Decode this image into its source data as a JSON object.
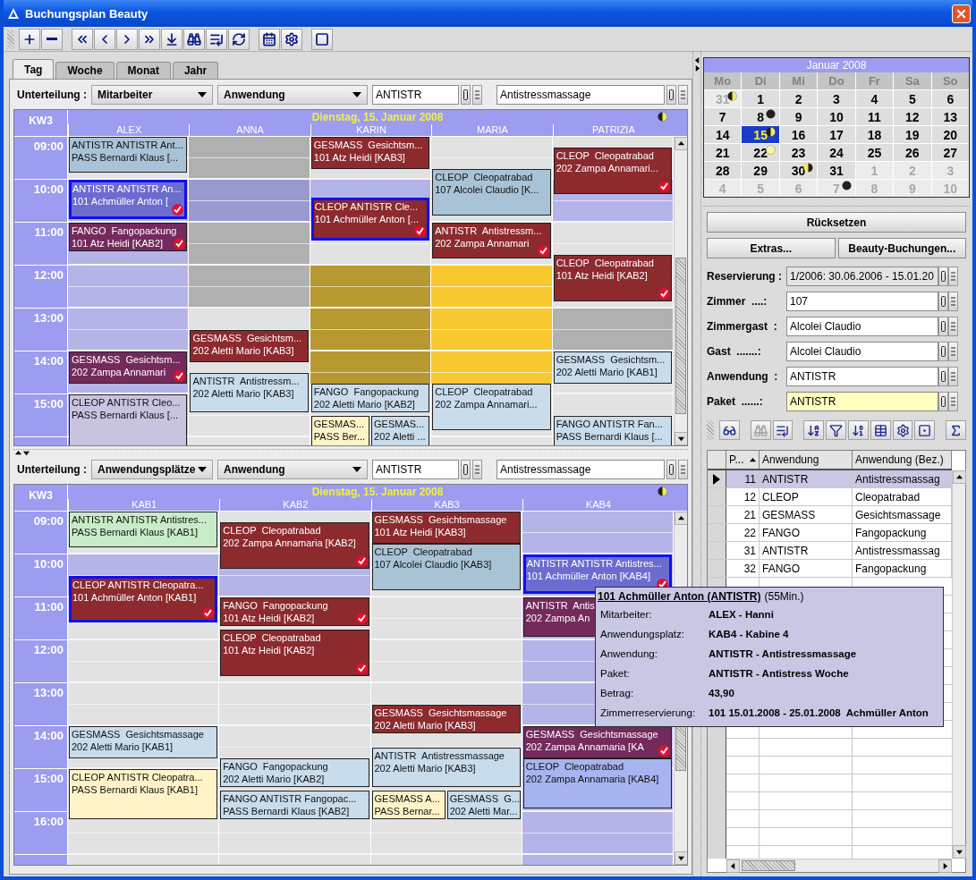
{
  "window": {
    "title": "Buchungsplan Beauty"
  },
  "view_tabs": [
    {
      "label": "Tag",
      "selected": true
    },
    {
      "label": "Woche",
      "selected": false
    },
    {
      "label": "Monat",
      "selected": false
    },
    {
      "label": "Jahr",
      "selected": false
    }
  ],
  "schedules": [
    {
      "subdivision_label": "Unterteilung :",
      "subdivision": "Mitarbeiter",
      "grouping": "Anwendung",
      "code": "ANTISTR",
      "name": "Antistressmassage",
      "week": "KW3",
      "date": "Dienstag, 15. Januar 2008",
      "hours": [
        "09:00",
        "10:00",
        "11:00",
        "12:00",
        "13:00",
        "14:00",
        "15:00"
      ],
      "columns": [
        {
          "name": "ALEX",
          "shading": [
            {
              "color": "#b4b4e8"
            }
          ],
          "events": [
            {
              "service": "ANTISTR ANTISTR Ant...",
              "guest": "PASS Bernardi Klaus [...",
              "color": "#a9c3d6",
              "checked": false,
              "selected": false
            },
            {
              "service": "ANTISTR ANTISTR An...",
              "guest": "101 Achmüller Anton [",
              "color": "#6c6cd0",
              "checked": true,
              "selected": true
            },
            {
              "service": "FANGO  Fangopackung",
              "guest": "101 Atz Heidi [KAB2]",
              "color": "#742a5c",
              "checked": true,
              "selected": false
            },
            {
              "service": "GESMASS  Gesichtsm...",
              "guest": "202 Zampa Annamari",
              "color": "#742a5c",
              "checked": true,
              "selected": false
            },
            {
              "service": "CLEOP ANTISTR Cleo...",
              "guest": "PASS Bernardi Klaus [...",
              "color": "#c8c4e0",
              "checked": false,
              "selected": false
            }
          ]
        },
        {
          "name": "ANNA",
          "shading": [
            {
              "color": "#b0b0b0"
            },
            {
              "color": "#9a9ad0"
            }
          ],
          "events": [
            {
              "service": "GESMASS  Gesichtsm...",
              "guest": "202 Aletti Mario [KAB3]",
              "color": "#8c2a2e",
              "checked": false,
              "selected": false
            },
            {
              "service": "ANTISTR  Antistressm...",
              "guest": "202 Aletti Mario [KAB3]",
              "color": "#c8dcec",
              "checked": false,
              "selected": false
            }
          ]
        },
        {
          "name": "KARIN",
          "shading": [
            {
              "color": "#b4b4e8"
            },
            {
              "color": "#b89830"
            }
          ],
          "events": [
            {
              "service": "GESMASS  Gesichtsm...",
              "guest": "101 Atz Heidi [KAB3]",
              "color": "#8c2a2e",
              "checked": false,
              "selected": false
            },
            {
              "service": "CLEOP ANTISTR Cle...",
              "guest": "101 Achmüller Anton [...",
              "color": "#8c2a2e",
              "checked": true,
              "selected": true
            },
            {
              "service": "FANGO  Fangopackung",
              "guest": "202 Aletti Mario [KAB2]",
              "color": "#c8dcec",
              "checked": false,
              "selected": false
            },
            {
              "service": "GESMAS...",
              "guest": "PASS Ber...",
              "color": "#fff4c8",
              "checked": false,
              "selected": false
            },
            {
              "service": "GESMAS...",
              "guest": "202 Aletti ...",
              "color": "#c8dcec",
              "checked": false,
              "selected": false
            }
          ]
        },
        {
          "name": "MARIA",
          "shading": [
            {
              "color": "#f8c830"
            }
          ],
          "events": [
            {
              "service": "CLEOP  Cleopatrabad",
              "guest": "107 Alcolei Claudio [K...",
              "color": "#a9c3d6",
              "checked": false,
              "selected": false
            },
            {
              "service": "ANTISTR  Antistressm...",
              "guest": "202 Zampa Annamari",
              "color": "#8c2a2e",
              "checked": true,
              "selected": false
            },
            {
              "service": "CLEOP  Cleopatrabad",
              "guest": "202 Zampa Annamari...",
              "color": "#c8dcec",
              "checked": false,
              "selected": false
            }
          ]
        },
        {
          "name": "PATRIZIA",
          "shading": [
            {
              "color": "#b4b4e8"
            },
            {
              "color": "#b0b0b0"
            }
          ],
          "events": [
            {
              "service": "CLEOP  Cleopatrabad",
              "guest": "202 Zampa Annamari...",
              "color": "#8c2a2e",
              "checked": true,
              "selected": false
            },
            {
              "service": "CLEOP  Cleopatrabad",
              "guest": "101 Atz Heidi [KAB2]",
              "color": "#8c2a2e",
              "checked": true,
              "selected": false
            },
            {
              "service": "GESMASS  Gesichtsm...",
              "guest": "202 Aletti Mario [KAB1]",
              "color": "#c8dcec",
              "checked": false,
              "selected": false
            },
            {
              "service": "FANGO ANTISTR Fan...",
              "guest": "PASS Bernardi Klaus [...",
              "color": "#c8dcec",
              "checked": false,
              "selected": false
            }
          ]
        }
      ]
    },
    {
      "subdivision_label": "Unterteilung :",
      "subdivision": "Anwendungsplätze",
      "grouping": "Anwendung",
      "code": "ANTISTR",
      "name": "Antistressmassage",
      "week": "KW3",
      "date": "Dienstag, 15. Januar 2008",
      "hours": [
        "09:00",
        "10:00",
        "11:00",
        "12:00",
        "13:00",
        "14:00",
        "15:00",
        "16:00"
      ],
      "columns": [
        {
          "name": "KAB1",
          "shading": [
            {
              "color": "#b4b4e8"
            }
          ],
          "events": [
            {
              "service": "ANTISTR ANTISTR Antistres...",
              "guest": "PASS Bernardi Klaus [KAB1]",
              "color": "#c8ecc8",
              "checked": false,
              "selected": false
            },
            {
              "service": "CLEOP ANTISTR Cleopatra...",
              "guest": "101 Achmüller Anton [KAB1]",
              "color": "#8c2a2e",
              "checked": true,
              "selected": true
            },
            {
              "service": "GESMASS  Gesichtsmassage",
              "guest": "202 Aletti Mario [KAB1]",
              "color": "#c8dcec",
              "checked": false,
              "selected": false
            },
            {
              "service": "CLEOP ANTISTR Cleopatra...",
              "guest": "PASS Bernardi Klaus [KAB1]",
              "color": "#fff4c8",
              "checked": false,
              "selected": false
            }
          ]
        },
        {
          "name": "KAB2",
          "shading": [
            {
              "color": "#b4b4e8"
            }
          ],
          "events": [
            {
              "service": "CLEOP  Cleopatrabad",
              "guest": "202 Zampa Annamaria [KAB2]",
              "color": "#8c2a2e",
              "checked": true,
              "selected": false
            },
            {
              "service": "FANGO  Fangopackung",
              "guest": "101 Atz Heidi [KAB2]",
              "color": "#8c2a2e",
              "checked": true,
              "selected": false
            },
            {
              "service": "CLEOP  Cleopatrabad",
              "guest": "101 Atz Heidi [KAB2]",
              "color": "#8c2a2e",
              "checked": true,
              "selected": false
            },
            {
              "service": "FANGO  Fangopackung",
              "guest": "202 Aletti Mario [KAB2]",
              "color": "#c8dcec",
              "checked": false,
              "selected": false
            },
            {
              "service": "FANGO ANTISTR Fangopac...",
              "guest": "PASS Bernardi Klaus [KAB2]",
              "color": "#c8dcec",
              "checked": false,
              "selected": false
            }
          ]
        },
        {
          "name": "KAB3",
          "events": [
            {
              "service": "GESMASS  Gesichtsmassage",
              "guest": "101 Atz Heidi [KAB3]",
              "color": "#8c2a2e",
              "checked": false,
              "selected": false
            },
            {
              "service": "CLEOP  Cleopatrabad",
              "guest": "107 Alcolei Claudio [KAB3]",
              "color": "#a9c3d6",
              "checked": false,
              "selected": false
            },
            {
              "service": "GESMASS  Gesichtsmassage",
              "guest": "202 Aletti Mario [KAB3]",
              "color": "#8c2a2e",
              "checked": false,
              "selected": false
            },
            {
              "service": "ANTISTR  Antistressmassage",
              "guest": "202 Aletti Mario [KAB3]",
              "color": "#c8dcec",
              "checked": false,
              "selected": false
            },
            {
              "service": "GESMASS A...",
              "guest": "PASS Bernar...",
              "color": "#fff4c8",
              "checked": false,
              "selected": false
            },
            {
              "service": "GESMASS  G...",
              "guest": "202 Aletti Mar...",
              "color": "#c8dcec",
              "checked": false,
              "selected": false
            }
          ]
        },
        {
          "name": "KAB4",
          "shading": [
            {
              "color": "#b4b4e8"
            }
          ],
          "events": [
            {
              "service": "ANTISTR ANTISTR Antistres...",
              "guest": "101 Achmüller Anton [KAB4]",
              "color": "#6c6cd0",
              "checked": true,
              "selected": true
            },
            {
              "service": "ANTISTR  Antis",
              "guest": "202 Zampa An",
              "color": "#742a5c",
              "checked": false,
              "selected": false
            },
            {
              "service": "GESMASS  Gesichtsmassage",
              "guest": "202 Zampa Annamaria [KA",
              "color": "#742a5c",
              "checked": true,
              "selected": false
            },
            {
              "service": "CLEOP  Cleopatrabad",
              "guest": "202 Zampa Annamaria [KAB4]",
              "color": "#a8b4f0",
              "checked": false,
              "selected": false
            }
          ]
        }
      ]
    }
  ],
  "calendar": {
    "month": "Januar 2008",
    "weekdays": [
      "Mo",
      "Di",
      "Mi",
      "Do",
      "Fr",
      "Sa",
      "So"
    ],
    "days": [
      {
        "day": "31",
        "outside": true,
        "selected": false,
        "kind": "firstquarter"
      },
      {
        "day": "1",
        "outside": false,
        "selected": false,
        "kind": "plain"
      },
      {
        "day": "2",
        "outside": false,
        "selected": false,
        "kind": "plain"
      },
      {
        "day": "3",
        "outside": false,
        "selected": false,
        "kind": "plain"
      },
      {
        "day": "4",
        "outside": false,
        "selected": false,
        "kind": "plain"
      },
      {
        "day": "5",
        "outside": false,
        "selected": false,
        "kind": "plain"
      },
      {
        "day": "6",
        "outside": false,
        "selected": false,
        "kind": "plain"
      },
      {
        "day": "7",
        "outside": false,
        "selected": false,
        "kind": "plain"
      },
      {
        "day": "8",
        "outside": false,
        "selected": false,
        "kind": "newmoon"
      },
      {
        "day": "9",
        "outside": false,
        "selected": false,
        "kind": "plain"
      },
      {
        "day": "10",
        "outside": false,
        "selected": false,
        "kind": "plain"
      },
      {
        "day": "11",
        "outside": false,
        "selected": false,
        "kind": "plain"
      },
      {
        "day": "12",
        "outside": false,
        "selected": false,
        "kind": "plain"
      },
      {
        "day": "13",
        "outside": false,
        "selected": false,
        "kind": "plain"
      },
      {
        "day": "14",
        "outside": false,
        "selected": false,
        "kind": "plain"
      },
      {
        "day": "15",
        "outside": false,
        "selected": true,
        "kind": "firstquarter"
      },
      {
        "day": "16",
        "outside": false,
        "selected": false,
        "kind": "plain"
      },
      {
        "day": "17",
        "outside": false,
        "selected": false,
        "kind": "plain"
      },
      {
        "day": "18",
        "outside": false,
        "selected": false,
        "kind": "plain"
      },
      {
        "day": "19",
        "outside": false,
        "selected": false,
        "kind": "plain"
      },
      {
        "day": "20",
        "outside": false,
        "selected": false,
        "kind": "plain"
      },
      {
        "day": "21",
        "outside": false,
        "selected": false,
        "kind": "plain"
      },
      {
        "day": "22",
        "outside": false,
        "selected": false,
        "kind": "fullmoon"
      },
      {
        "day": "23",
        "outside": false,
        "selected": false,
        "kind": "plain"
      },
      {
        "day": "24",
        "outside": false,
        "selected": false,
        "kind": "plain"
      },
      {
        "day": "25",
        "outside": false,
        "selected": false,
        "kind": "plain"
      },
      {
        "day": "26",
        "outside": false,
        "selected": false,
        "kind": "plain"
      },
      {
        "day": "27",
        "outside": false,
        "selected": false,
        "kind": "plain"
      },
      {
        "day": "28",
        "outside": false,
        "selected": false,
        "kind": "plain"
      },
      {
        "day": "29",
        "outside": false,
        "selected": false,
        "kind": "plain"
      },
      {
        "day": "30",
        "outside": false,
        "selected": false,
        "kind": "lastquarter"
      },
      {
        "day": "31",
        "outside": false,
        "selected": false,
        "kind": "plain"
      },
      {
        "day": "1",
        "outside": true,
        "selected": false,
        "kind": "plain"
      },
      {
        "day": "2",
        "outside": true,
        "selected": false,
        "kind": "plain"
      },
      {
        "day": "3",
        "outside": true,
        "selected": false,
        "kind": "plain"
      },
      {
        "day": "4",
        "outside": true,
        "selected": false,
        "kind": "plain"
      },
      {
        "day": "5",
        "outside": true,
        "selected": false,
        "kind": "plain"
      },
      {
        "day": "6",
        "outside": true,
        "selected": false,
        "kind": "plain"
      },
      {
        "day": "7",
        "outside": true,
        "selected": false,
        "kind": "newmoon"
      },
      {
        "day": "8",
        "outside": true,
        "selected": false,
        "kind": "plain"
      },
      {
        "day": "9",
        "outside": true,
        "selected": false,
        "kind": "plain"
      },
      {
        "day": "10",
        "outside": true,
        "selected": false,
        "kind": "plain"
      }
    ]
  },
  "buttons": {
    "reset": "Rücksetzen",
    "extras": "Extras...",
    "bookings": "Beauty-Buchungen..."
  },
  "form": [
    {
      "label": "Reservierung :",
      "value": "1/2006: 30.06.2006 - 15.01.20",
      "disabled": true
    },
    {
      "label": "Zimmer  ....:",
      "value": "107",
      "disabled": false,
      "focused": false
    },
    {
      "label": "Zimmergast  :",
      "value": "Alcolei Claudio",
      "disabled": false,
      "focused": false
    },
    {
      "label": "Gast  .......:",
      "value": "Alcolei Claudio",
      "disabled": false,
      "focused": false
    },
    {
      "label": "Anwendung  :",
      "value": "ANTISTR",
      "disabled": false,
      "focused": false
    },
    {
      "label": "Paket  ......:",
      "value": "ANTISTR",
      "disabled": false,
      "focused": true
    }
  ],
  "table": {
    "columns": [
      "P...",
      "Anwendung",
      "Anwendung (Bez.)"
    ],
    "rows": [
      {
        "cells": [
          "11",
          "ANTISTR",
          "Antistressmassag"
        ],
        "selected": true
      },
      {
        "cells": [
          "12",
          "CLEOP",
          "Cleopatrabad"
        ],
        "selected": false
      },
      {
        "cells": [
          "21",
          "GESMASS",
          "Gesichtsmassage"
        ],
        "selected": false
      },
      {
        "cells": [
          "22",
          "FANGO",
          "Fangopackung"
        ],
        "selected": false
      },
      {
        "cells": [
          "31",
          "ANTISTR",
          "Antistressmassag"
        ],
        "selected": false
      },
      {
        "cells": [
          "32",
          "FANGO",
          "Fangopackung"
        ],
        "selected": false
      }
    ]
  },
  "tooltip": {
    "title": "101 Achmüller Anton (ANTISTR)",
    "duration": "(55Min.)",
    "rows": [
      {
        "label": "Mitarbeiter:",
        "value": "ALEX - Hanni"
      },
      {
        "label": "Anwendungsplatz:",
        "value": "KAB4 - Kabine 4"
      },
      {
        "label": "Anwendung:",
        "value": "ANTISTR - Antistressmassage"
      },
      {
        "label": "Paket:",
        "value": "ANTISTR - Antistress Woche"
      },
      {
        "label": "Betrag:",
        "value": "43,90"
      },
      {
        "label": "Zimmerreservierung:",
        "value": "101 15.01.2008 - 25.01.2008  Achmüller Anton"
      }
    ]
  }
}
